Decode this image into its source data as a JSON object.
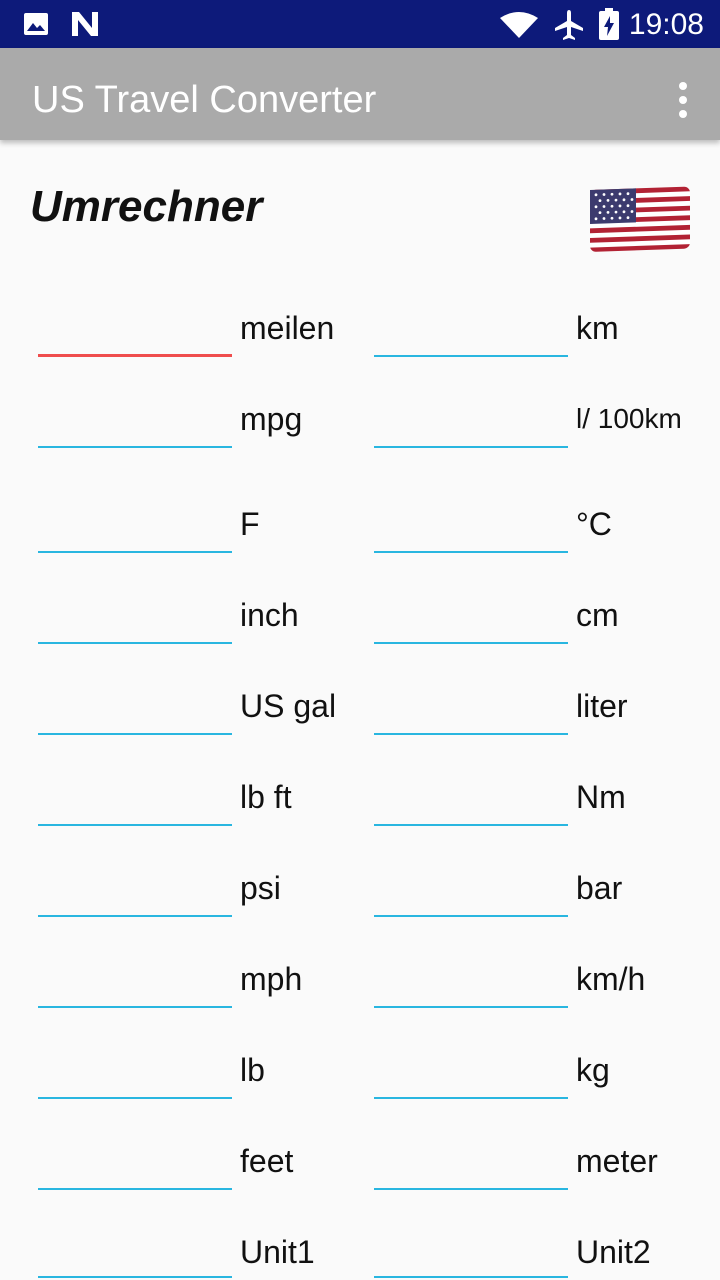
{
  "status_bar": {
    "time": "19:08",
    "icons": [
      "image-icon",
      "n-logo-icon",
      "wifi-icon",
      "airplane-mode-icon",
      "battery-charging-icon"
    ]
  },
  "app_bar": {
    "title": "US Travel Converter",
    "menu_icon": "more-vert-icon"
  },
  "heading": "Umrechner",
  "flag_icon": "us-flag-icon",
  "colors": {
    "status_bar": "#0d1a7a",
    "app_bar": "#aaaaaa",
    "underline": "#29b6e0",
    "focused_underline": "#ef4d4d"
  },
  "rows": [
    {
      "left_unit": "meilen",
      "left_value": "",
      "right_unit": "km",
      "right_value": ""
    },
    {
      "left_unit": "mpg",
      "left_value": "",
      "right_unit": "l/ 100km",
      "right_value": ""
    },
    {
      "left_unit": "F",
      "left_value": "",
      "right_unit": "°C",
      "right_value": ""
    },
    {
      "left_unit": "inch",
      "left_value": "",
      "right_unit": "cm",
      "right_value": ""
    },
    {
      "left_unit": "US gal",
      "left_value": "",
      "right_unit": "liter",
      "right_value": ""
    },
    {
      "left_unit": "lb ft",
      "left_value": "",
      "right_unit": "Nm",
      "right_value": ""
    },
    {
      "left_unit": "psi",
      "left_value": "",
      "right_unit": "bar",
      "right_value": ""
    },
    {
      "left_unit": "mph",
      "left_value": "",
      "right_unit": "km/h",
      "right_value": ""
    },
    {
      "left_unit": "lb",
      "left_value": "",
      "right_unit": "kg",
      "right_value": ""
    },
    {
      "left_unit": "feet",
      "left_value": "",
      "right_unit": "meter",
      "right_value": ""
    },
    {
      "left_unit": "Unit1",
      "left_value": "",
      "right_unit": "Unit2",
      "right_value": ""
    }
  ]
}
